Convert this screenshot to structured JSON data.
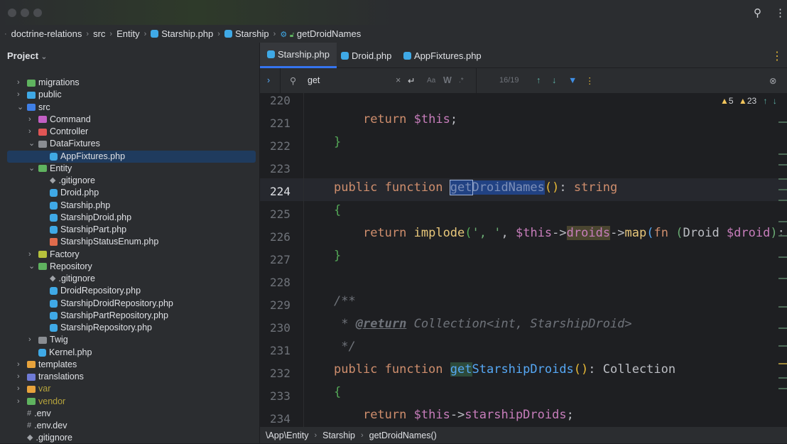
{
  "breadcrumb": [
    "doctrine-relations",
    "src",
    "Entity",
    "Starship.php",
    "Starship",
    "getDroidNames"
  ],
  "sidebar": {
    "title": "Project",
    "items": [
      {
        "label": "migrations",
        "level": 0,
        "type": "folder",
        "color": "#5fb35f",
        "arrow": "›"
      },
      {
        "label": "public",
        "level": 0,
        "type": "folder",
        "color": "#3fa9e6",
        "arrow": "›"
      },
      {
        "label": "src",
        "level": 0,
        "type": "folder",
        "color": "#3f7fe6",
        "arrow": "⌄"
      },
      {
        "label": "Command",
        "level": 1,
        "type": "folder",
        "color": "#c35fc3",
        "arrow": "›"
      },
      {
        "label": "Controller",
        "level": 1,
        "type": "folder",
        "color": "#e05555",
        "arrow": "›"
      },
      {
        "label": "DataFixtures",
        "level": 1,
        "type": "folder",
        "color": "#8a8d92",
        "arrow": "⌄"
      },
      {
        "label": "AppFixtures.php",
        "level": 2,
        "type": "php",
        "selected": true
      },
      {
        "label": "Entity",
        "level": 1,
        "type": "folder",
        "color": "#5fb35f",
        "arrow": "⌄"
      },
      {
        "label": ".gitignore",
        "level": 2,
        "type": "git"
      },
      {
        "label": "Droid.php",
        "level": 2,
        "type": "php"
      },
      {
        "label": "Starship.php",
        "level": 2,
        "type": "php"
      },
      {
        "label": "StarshipDroid.php",
        "level": 2,
        "type": "php"
      },
      {
        "label": "StarshipPart.php",
        "level": 2,
        "type": "php"
      },
      {
        "label": "StarshipStatusEnum.php",
        "level": 2,
        "type": "enum"
      },
      {
        "label": "Factory",
        "level": 1,
        "type": "folder",
        "color": "#b5c13c",
        "arrow": "›"
      },
      {
        "label": "Repository",
        "level": 1,
        "type": "folder",
        "color": "#5fb35f",
        "arrow": "⌄"
      },
      {
        "label": ".gitignore",
        "level": 2,
        "type": "git"
      },
      {
        "label": "DroidRepository.php",
        "level": 2,
        "type": "php"
      },
      {
        "label": "StarshipDroidRepository.php",
        "level": 2,
        "type": "php"
      },
      {
        "label": "StarshipPartRepository.php",
        "level": 2,
        "type": "php"
      },
      {
        "label": "StarshipRepository.php",
        "level": 2,
        "type": "php"
      },
      {
        "label": "Twig",
        "level": 1,
        "type": "folder",
        "color": "#8a8d92",
        "arrow": "›"
      },
      {
        "label": "Kernel.php",
        "level": 1,
        "type": "php"
      },
      {
        "label": "templates",
        "level": 0,
        "type": "folder",
        "color": "#e8a33c",
        "arrow": "›"
      },
      {
        "label": "translations",
        "level": 0,
        "type": "folder",
        "color": "#6f7bd6",
        "arrow": "›"
      },
      {
        "label": "var",
        "level": 0,
        "type": "folder",
        "color": "#e8a33c",
        "arrow": "›",
        "muted": true
      },
      {
        "label": "vendor",
        "level": 0,
        "type": "folder",
        "color": "#5fb35f",
        "arrow": "›",
        "muted": true
      },
      {
        "label": ".env",
        "level": 0,
        "type": "env"
      },
      {
        "label": ".env.dev",
        "level": 0,
        "type": "env"
      },
      {
        "label": ".gitignore",
        "level": 0,
        "type": "git"
      }
    ]
  },
  "tabs": [
    "Starship.php",
    "Droid.php",
    "AppFixtures.php"
  ],
  "find": {
    "query": "get",
    "count": "16/19",
    "case": "Aa",
    "word": "W",
    "regex": ".*"
  },
  "inspections": {
    "warnings": "5",
    "weak_warnings": "23"
  },
  "line_numbers": [
    "220",
    "221",
    "222",
    "223",
    "224",
    "225",
    "226",
    "227",
    "228",
    "229",
    "230",
    "231",
    "232",
    "233",
    "234"
  ],
  "status": [
    "\\App\\Entity",
    "Starship",
    "getDroidNames()"
  ]
}
